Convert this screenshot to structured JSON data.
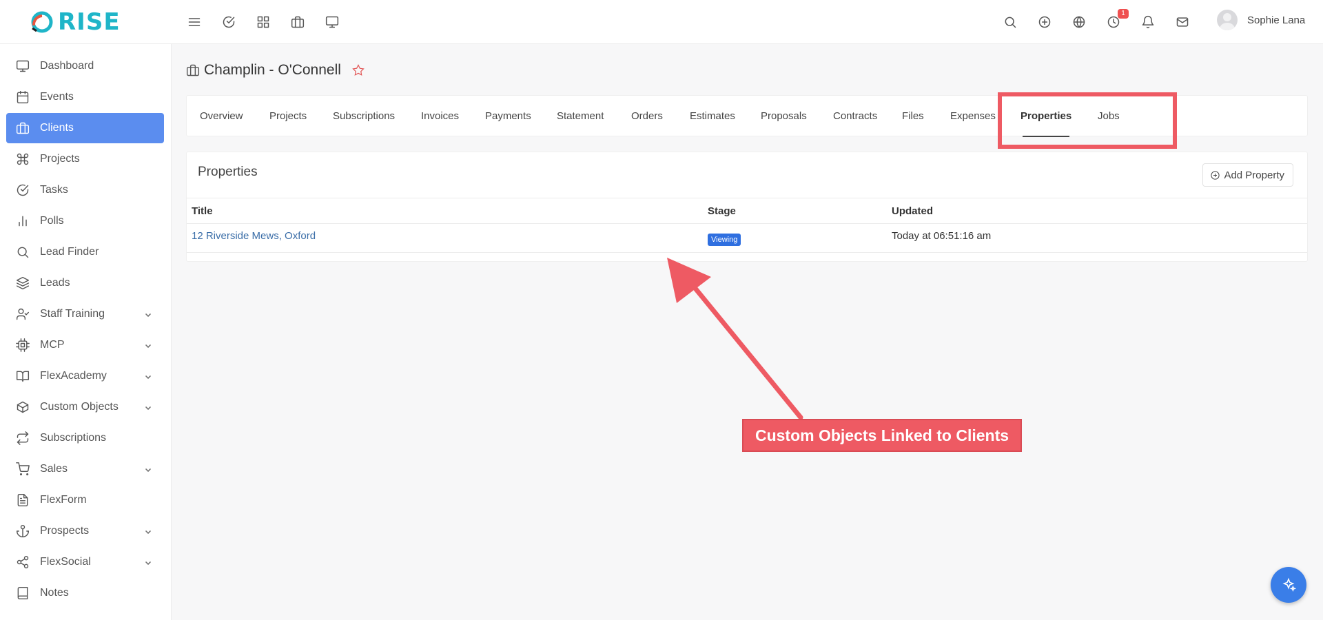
{
  "app": {
    "logo_text": "RISE"
  },
  "header": {
    "notification_count": "1",
    "user_name": "Sophie Lana"
  },
  "sidebar": {
    "items": [
      {
        "label": "Dashboard",
        "icon": "monitor-icon"
      },
      {
        "label": "Events",
        "icon": "calendar-icon"
      },
      {
        "label": "Clients",
        "icon": "briefcase-icon",
        "active": true
      },
      {
        "label": "Projects",
        "icon": "command-icon"
      },
      {
        "label": "Tasks",
        "icon": "check-circle-icon"
      },
      {
        "label": "Polls",
        "icon": "bar-chart-icon"
      },
      {
        "label": "Lead Finder",
        "icon": "search-icon"
      },
      {
        "label": "Leads",
        "icon": "layers-icon"
      },
      {
        "label": "Staff Training",
        "icon": "user-check-icon",
        "submenu": true
      },
      {
        "label": "MCP",
        "icon": "cpu-icon",
        "submenu": true
      },
      {
        "label": "FlexAcademy",
        "icon": "book-open-icon",
        "submenu": true
      },
      {
        "label": "Custom Objects",
        "icon": "box-icon",
        "submenu": true
      },
      {
        "label": "Subscriptions",
        "icon": "repeat-icon"
      },
      {
        "label": "Sales",
        "icon": "cart-icon",
        "submenu": true
      },
      {
        "label": "FlexForm",
        "icon": "file-text-icon"
      },
      {
        "label": "Prospects",
        "icon": "anchor-icon",
        "submenu": true
      },
      {
        "label": "FlexSocial",
        "icon": "share-icon",
        "submenu": true
      },
      {
        "label": "Notes",
        "icon": "book-icon"
      }
    ]
  },
  "page": {
    "title": "Champlin - O'Connell"
  },
  "tabs": [
    {
      "label": "Overview"
    },
    {
      "label": "Projects"
    },
    {
      "label": "Subscriptions"
    },
    {
      "label": "Invoices"
    },
    {
      "label": "Payments"
    },
    {
      "label": "Statement"
    },
    {
      "label": "Orders"
    },
    {
      "label": "Estimates"
    },
    {
      "label": "Proposals"
    },
    {
      "label": "Contracts"
    },
    {
      "label": "Files"
    },
    {
      "label": "Expenses"
    },
    {
      "label": "Properties",
      "active": true
    },
    {
      "label": "Jobs"
    }
  ],
  "properties": {
    "title": "Properties",
    "add_label": "Add Property",
    "columns": [
      "Title",
      "Stage",
      "Updated"
    ],
    "rows": [
      {
        "title": "12 Riverside Mews, Oxford",
        "stage": "Viewing",
        "updated": "Today at 06:51:16 am"
      }
    ]
  },
  "annotation": {
    "callout_text": "Custom Objects Linked to Clients",
    "color": "#ee5a63"
  },
  "colors": {
    "accent": "#5b8def",
    "brand": "#1fb5c8",
    "badge": "#2f6fe0"
  }
}
